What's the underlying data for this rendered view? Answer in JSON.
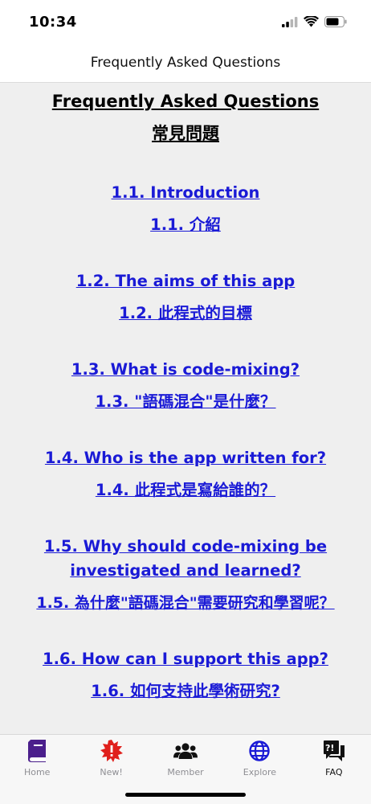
{
  "status_bar": {
    "time": "10:34"
  },
  "nav": {
    "title": "Frequently Asked Questions"
  },
  "content": {
    "title": "Frequently Asked Questions",
    "subtitle": "常見問題",
    "items": [
      {
        "en": "1.1. Introduction",
        "zh": "1.1. 介紹"
      },
      {
        "en": "1.2. The aims of this app",
        "zh": "1.2. 此程式的目標"
      },
      {
        "en": "1.3. What is code-mixing?",
        "zh": "1.3. \"語碼混合\"是什麼？"
      },
      {
        "en": "1.4. Who is the app written for?",
        "zh": "1.4. 此程式是寫給誰的？"
      },
      {
        "en": "1.5. Why should code-mixing be investigated and learned?",
        "zh": "1.5. 為什麼\"語碼混合\"需要研究和學習呢？"
      },
      {
        "en": "1.6. How can I support this app?",
        "zh": "1.6. 如何支持此學術研究?"
      }
    ]
  },
  "tab_bar": {
    "tabs": [
      {
        "label": "Home",
        "icon": "book-icon",
        "color": "#4b1f8c"
      },
      {
        "label": "New!",
        "icon": "alert-burst-icon",
        "color": "#e0201c"
      },
      {
        "label": "Member",
        "icon": "users-icon",
        "color": "#111111"
      },
      {
        "label": "Explore",
        "icon": "globe-icon",
        "color": "#1a1ad6"
      },
      {
        "label": "FAQ",
        "icon": "faq-bubble-icon",
        "color": "#111111"
      }
    ],
    "active": "FAQ"
  },
  "colors": {
    "link": "#1a1ad6",
    "content_bg": "#efefef"
  }
}
